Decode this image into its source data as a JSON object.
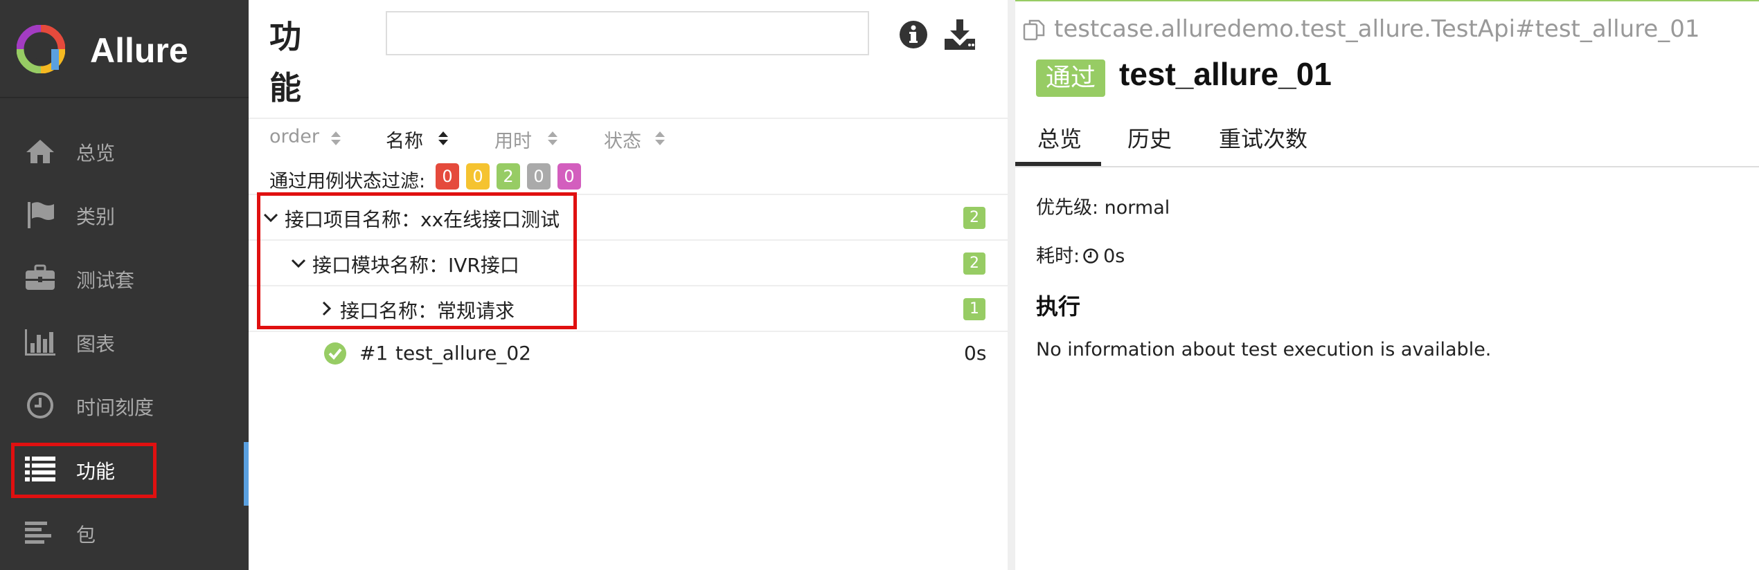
{
  "app": {
    "name": "Allure",
    "logo_colors": [
      "#e54a3c",
      "#f5b921",
      "#97cc64",
      "#a33cc2",
      "#5aa0e0"
    ]
  },
  "sidebar": {
    "items": [
      {
        "label": "总览",
        "icon": "home-icon"
      },
      {
        "label": "类别",
        "icon": "flag-icon"
      },
      {
        "label": "测试套",
        "icon": "briefcase-icon"
      },
      {
        "label": "图表",
        "icon": "bar-chart-icon"
      },
      {
        "label": "时间刻度",
        "icon": "clock-icon"
      },
      {
        "label": "功能",
        "icon": "list-icon",
        "active": true
      },
      {
        "label": "包",
        "icon": "align-left-icon"
      }
    ]
  },
  "middle": {
    "title": "功能",
    "search": {
      "value": "",
      "placeholder": ""
    },
    "sort": [
      {
        "label": "order",
        "active": false
      },
      {
        "label": "名称",
        "active": true
      },
      {
        "label": "用时",
        "active": false
      },
      {
        "label": "状态",
        "active": false
      }
    ],
    "filter": {
      "label": "通过用例状态过滤:",
      "badges": [
        {
          "value": "0",
          "color": "#e54a3c",
          "status": "failed"
        },
        {
          "value": "0",
          "color": "#f5c330",
          "status": "broken"
        },
        {
          "value": "2",
          "color": "#97cc64",
          "status": "passed"
        },
        {
          "value": "0",
          "color": "#aaaaaa",
          "status": "skipped"
        },
        {
          "value": "0",
          "color": "#d35ebe",
          "status": "unknown"
        }
      ]
    },
    "tree": [
      {
        "label": "接口项目名称：xx在线接口测试",
        "count": "2",
        "expanded": true
      },
      {
        "label": "接口模块名称：IVR接口",
        "count": "2",
        "expanded": true
      },
      {
        "label": "接口名称：常规请求",
        "count": "1",
        "expanded": false
      }
    ],
    "case": {
      "num": "#1",
      "name": "test_allure_02",
      "time": "0s",
      "status": "passed"
    }
  },
  "detail": {
    "fullname": "testcase.alluredemo.test_allure.TestApi#test_allure_01",
    "status_label": "通过",
    "status_color": "#97cc64",
    "title": "test_allure_01",
    "tabs": [
      "总览",
      "历史",
      "重试次数"
    ],
    "priority": "优先级: normal",
    "duration_label": "耗时:",
    "duration_value": "0s",
    "execution_title": "执行",
    "execution_text": "No information about test execution is available."
  }
}
